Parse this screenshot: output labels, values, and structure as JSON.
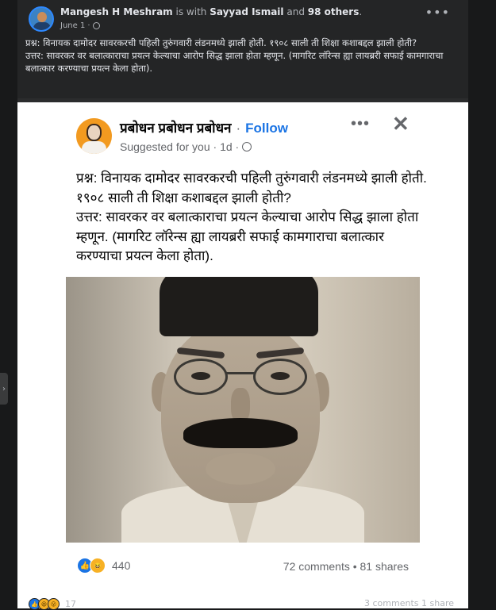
{
  "post": {
    "author": "Mangesh H Meshram",
    "with_text": "is with",
    "tagged": "Sayyad Ismail",
    "and_text": "and",
    "others": "98 others",
    "date": "June 1",
    "meta_dot": "·",
    "text_line1": "प्रश्न: विनायक दामोदर सावरकरची पहिली तुरुंगवारी लंडनमध्ये झाली होती. १९०८ साली ती शिक्षा कशाबद्दल झाली होती?",
    "text_line2": "उत्तर: सावरकर वर बलात्काराचा प्रयत्न केल्याचा आरोप सिद्ध झाला होता म्हणून. (मागरिट लॉरेन्स ह्या लायब्ररी सफाई कामगाराचा बलात्कार करण्याचा प्रयत्न केला होता).",
    "more_icon": "ellipsis-icon"
  },
  "shared": {
    "page_name": "प्रबोधन प्रबोधन प्रबोधन",
    "separator": "·",
    "follow_label": "Follow",
    "suggested": "Suggested for you · 1d ·",
    "more_icon": "ellipsis-icon",
    "close_icon": "close-icon",
    "text_line1": "प्रश्न: विनायक दामोदर सावरकरची पहिली तुरुंगवारी लंडनमध्ये झाली होती. १९०८ साली ती शिक्षा कशाबद्दल झाली होती?",
    "text_line2": "उत्तर: सावरकर वर बलात्काराचा प्रयत्न केल्याचा आरोप सिद्ध झाला होता म्हणून. (मागरिट लॉरेन्स ह्या लायब्ररी सफाई कामगाराचा बलात्कार करण्याचा प्रयत्न केला होता).",
    "reaction_count": "440",
    "stats": "72 comments • 81 shares"
  },
  "bottom": {
    "reaction_count": "17",
    "stats": "3 comments   1 share"
  },
  "colors": {
    "background": "#18191a",
    "card": "#242526",
    "accent": "#1b74e4"
  }
}
